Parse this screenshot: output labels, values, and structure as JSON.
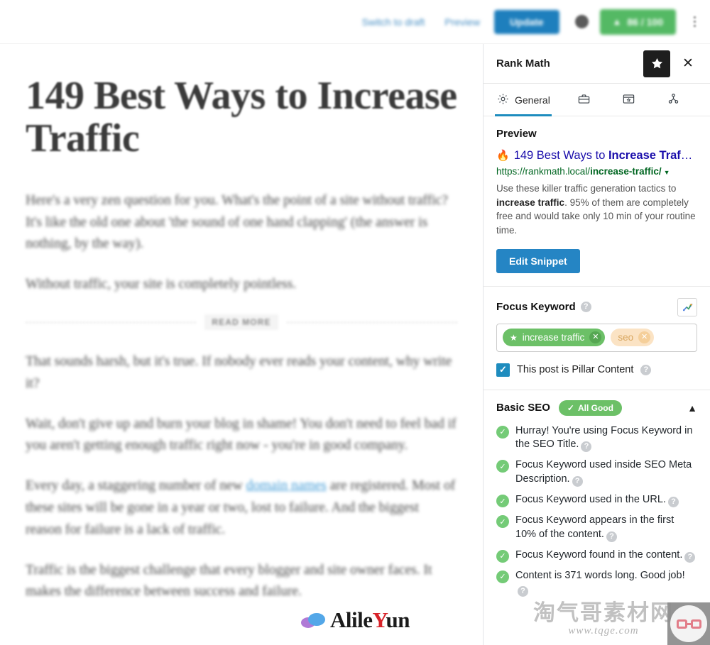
{
  "toolbar": {
    "switch_to_draft": "Switch to draft",
    "preview": "Preview",
    "update": "Update",
    "seo_score": "86 / 100",
    "seo_score_icon": "trophy-icon",
    "settings_icon": "settings-dot-icon",
    "more_icon": "kebab-menu-icon"
  },
  "editor": {
    "title": "149 Best Ways to Increase Traffic",
    "paragraphs": [
      "Here's a very zen question for you. What's the point of a site without traffic? It's like the old one about 'the sound of one hand clapping' (the answer is nothing, by the way).",
      "Without traffic, your site is completely pointless."
    ],
    "read_more_label": "READ MORE",
    "paragraphs_after": [
      "That sounds harsh, but it's true. If nobody ever reads your content, why write it?",
      "Wait, don't give up and burn your blog in shame! You don't need to feel bad if you aren't getting enough traffic right now - you're in good company."
    ],
    "link_paragraph": {
      "before": "Every day, a staggering number of new ",
      "link": "domain names",
      "after": " are registered. Most of these sites will be gone in a year or two, lost to failure. And the biggest reason for failure is a lack of traffic."
    },
    "last_paragraph": "Traffic is the biggest challenge that every blogger and site owner faces. It makes the difference between success and failure."
  },
  "sidebar": {
    "title": "Rank Math",
    "star_icon": "star-icon",
    "close_icon": "close-icon",
    "tabs": [
      {
        "label": "General",
        "icon": "gear-icon",
        "active": true
      },
      {
        "label": "",
        "icon": "briefcase-icon",
        "active": false
      },
      {
        "label": "",
        "icon": "schema-window-icon",
        "active": false
      },
      {
        "label": "",
        "icon": "social-share-icon",
        "active": false
      }
    ],
    "preview": {
      "heading": "Preview",
      "fire_icon": "fire-icon",
      "title_plain": "149 Best Ways to ",
      "title_bold": "Increase Traf",
      "title_ellipsis": "…",
      "url_base": "https://rankmath.local/",
      "url_slug": "increase-traffic/",
      "url_caret": "caret-down-icon",
      "description_1": "Use these killer traffic generation tactics to ",
      "description_bold": "increase traffic",
      "description_2": ". 95% of them are completely free and would take only 10 min of your routine time.",
      "edit_snippet_label": "Edit Snippet"
    },
    "focus_keyword": {
      "heading": "Focus Keyword",
      "help_icon": "help-icon",
      "trend_icon": "trending-up-icon",
      "chips": [
        {
          "label": "increase traffic",
          "state": "primary",
          "star_icon": "star-icon",
          "remove_icon": "remove-icon"
        },
        {
          "label": "seo",
          "state": "faded",
          "remove_icon": "remove-icon"
        }
      ],
      "pillar_label": "This post is Pillar Content",
      "pillar_checked": true,
      "pillar_check_icon": "check-icon"
    },
    "basic_seo": {
      "heading": "Basic SEO",
      "badge": "All Good",
      "badge_icon": "check-icon",
      "collapse_icon": "chevron-up-icon",
      "items": [
        "Hurray! You're using Focus Keyword in the SEO Title.",
        "Focus Keyword used inside SEO Meta Description.",
        "Focus Keyword used in the URL.",
        "Focus Keyword appears in the first 10% of the content.",
        "Focus Keyword found in the content.",
        "Content is 371 words long. Good job!"
      ]
    }
  },
  "watermarks": {
    "brand": "AlileYun",
    "brand_y": "Y",
    "cn_text": "淘气哥素材网",
    "cn_url": "www.tqge.com"
  },
  "colors": {
    "accent_blue": "#1e8cbe",
    "green": "#6cc067",
    "link_blue": "#1a0dab",
    "url_green": "#006621",
    "update_blue": "#1e7fbd"
  }
}
